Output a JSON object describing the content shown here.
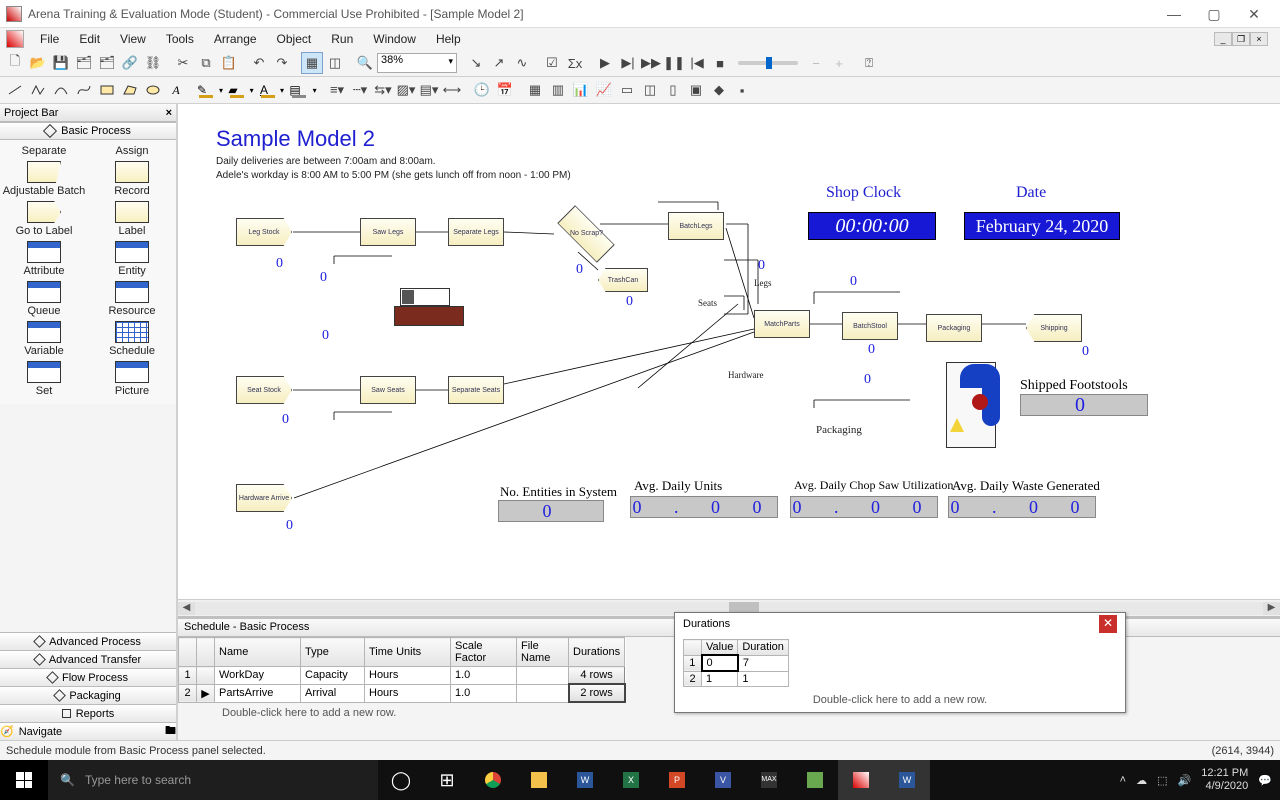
{
  "window": {
    "title": "Arena Training & Evaluation Mode (Student) - Commercial Use Prohibited - [Sample Model 2]"
  },
  "menu": {
    "items": [
      "File",
      "Edit",
      "View",
      "Tools",
      "Arrange",
      "Object",
      "Run",
      "Window",
      "Help"
    ]
  },
  "toolbar": {
    "zoom": "38%"
  },
  "projectbar": {
    "header": "Project Bar",
    "section": "Basic Process",
    "items": [
      [
        "Separate",
        "Assign"
      ],
      [
        "Adjustable Batch",
        "Record"
      ],
      [
        "Go to Label",
        "Label"
      ],
      [
        "Attribute",
        "Entity"
      ],
      [
        "Queue",
        "Resource"
      ],
      [
        "Variable",
        "Schedule"
      ],
      [
        "Set",
        "Picture"
      ]
    ],
    "bottom": [
      "Advanced Process",
      "Advanced Transfer",
      "Flow Process",
      "Packaging",
      "Reports",
      "Navigate"
    ]
  },
  "canvas": {
    "title": "Sample Model 2",
    "sub1": "Daily deliveries are between 7:00am and 8:00am.",
    "sub2": "Adele's workday is 8:00 AM to 5:00 PM (she gets lunch off from noon - 1:00 PM)",
    "clockLabel": "Shop Clock",
    "clock": "00:00:00",
    "dateLabel": "Date",
    "date": "February 24, 2020",
    "legs": "Legs",
    "seats": "Seats",
    "hardware": "Hardware",
    "packaging": "Packaging",
    "shipped_title": "Shipped Footstools",
    "shipped_val": "0",
    "stats": {
      "entities_title": "No. Entities in System",
      "entities_val": "0",
      "units_title": "Avg. Daily Units",
      "units_val": "0 . 0 0",
      "saw_title": "Avg. Daily Chop Saw Utilization",
      "saw_val": "0 . 0 0",
      "waste_title": "Avg. Daily Waste Generated",
      "waste_val": "0 . 0 0"
    },
    "modules": {
      "legstock": "Leg Stock",
      "sawlegs": "Saw Legs",
      "seplegs": "Separate Legs",
      "noscrap": "No Scrap?",
      "batchlegs": "BatchLegs",
      "trashcan": "TrashCan",
      "seatstock": "Seat Stock",
      "sawseats": "Saw Seats",
      "sepseats": "Separate Seats",
      "hwarrive": "Hardware Arrive",
      "matchparts": "MatchParts",
      "batchstool": "BatchStool",
      "packmod": "Packaging",
      "shipping": "Shipping"
    }
  },
  "sheet": {
    "title": "Schedule - Basic Process",
    "cols": [
      "Name",
      "Type",
      "Time Units",
      "Scale Factor",
      "File Name",
      "Durations"
    ],
    "rows": [
      {
        "n": "1",
        "name": "WorkDay",
        "type": "Capacity",
        "tu": "Hours",
        "sf": "1.0",
        "fn": "",
        "dur": "4 rows"
      },
      {
        "n": "2",
        "name": "PartsArrive",
        "type": "Arrival",
        "tu": "Hours",
        "sf": "1.0",
        "fn": "",
        "dur": "2 rows"
      }
    ],
    "hint": "Double-click here to add a new row."
  },
  "popup": {
    "title": "Durations",
    "cols": [
      "Value",
      "Duration"
    ],
    "rows": [
      {
        "n": "1",
        "v": "0",
        "d": "7"
      },
      {
        "n": "2",
        "v": "1",
        "d": "1"
      }
    ],
    "hint": "Double-click here to add a new row."
  },
  "status": {
    "msg": "Schedule module from Basic Process panel selected.",
    "coords": "(2614, 3944)"
  },
  "taskbar": {
    "search": "Type here to search",
    "time": "12:21 PM",
    "date": "4/9/2020"
  }
}
